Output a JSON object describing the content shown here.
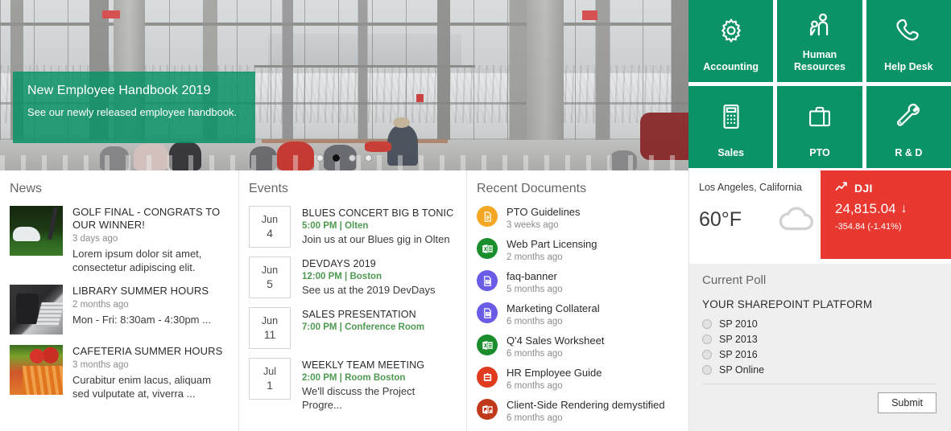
{
  "hero": {
    "title": "New Employee Handbook 2019",
    "subtitle": "See our newly released employee handbook.",
    "dots": [
      {
        "active": false
      },
      {
        "active": true
      },
      {
        "active": false
      },
      {
        "active": false
      }
    ]
  },
  "tiles": [
    {
      "label": "Accounting",
      "icon": "gear-icon",
      "color": "#0b9267"
    },
    {
      "label": "Human\nResources",
      "icon": "people-icon",
      "color": "#0b9267"
    },
    {
      "label": "Help Desk",
      "icon": "phone-icon",
      "color": "#0b9267"
    },
    {
      "label": "Sales",
      "icon": "calculator-icon",
      "color": "#0b9267"
    },
    {
      "label": "PTO",
      "icon": "briefcase-icon",
      "color": "#0b9267"
    },
    {
      "label": "R & D",
      "icon": "wrench-icon",
      "color": "#0b9267"
    }
  ],
  "news": {
    "title": "News",
    "items": [
      {
        "title": "GOLF FINAL - CONGRATS TO OUR WINNER!",
        "date": "3 days ago",
        "description": "Lorem ipsum dolor sit amet, consectetur adipiscing elit.",
        "thumb": "golf-thumbnail"
      },
      {
        "title": "LIBRARY SUMMER HOURS",
        "date": "2 months ago",
        "description": "Mon - Fri:  8:30am - 4:30pm ...",
        "thumb": "laptop-thumbnail"
      },
      {
        "title": "CAFETERIA SUMMER HOURS",
        "date": "3 months ago",
        "description": "Curabitur enim lacus, aliquam sed vulputate at, viverra ...",
        "thumb": "vegetables-thumbnail"
      }
    ]
  },
  "events": {
    "title": "Events",
    "items": [
      {
        "month": "Jun",
        "day": "4",
        "title": "BLUES CONCERT BIG B TONIC",
        "meta": "5:00 PM | Olten",
        "description": "Join us at our Blues gig in Olten"
      },
      {
        "month": "Jun",
        "day": "5",
        "title": "DEVDAYS 2019",
        "meta": "12:00 PM | Boston",
        "description": "See us at the 2019 DevDays"
      },
      {
        "month": "Jun",
        "day": "11",
        "title": "SALES PRESENTATION",
        "meta": "7:00 PM | Conference Room",
        "description": ""
      },
      {
        "month": "Jul",
        "day": "1",
        "title": "WEEKLY TEAM MEETING",
        "meta": "2:00 PM | Room Boston",
        "description": "We'll discuss the Project Progre..."
      }
    ]
  },
  "documents": {
    "title": "Recent Documents",
    "items": [
      {
        "title": "PTO Guidelines",
        "date": "3 weeks ago",
        "icon": "document-icon",
        "color": "#f5a623"
      },
      {
        "title": "Web Part Licensing",
        "date": "2 months ago",
        "icon": "excel-icon",
        "color": "#1a8d2c"
      },
      {
        "title": "faq-banner",
        "date": "5 months ago",
        "icon": "image-icon",
        "color": "#6b5ce7"
      },
      {
        "title": "Marketing Collateral",
        "date": "6 months ago",
        "icon": "image-icon",
        "color": "#6b5ce7"
      },
      {
        "title": "Q'4 Sales Worksheet",
        "date": "6 months ago",
        "icon": "excel-icon",
        "color": "#1a8d2c"
      },
      {
        "title": "HR Employee Guide",
        "date": "6 months ago",
        "icon": "zip-icon",
        "color": "#e03b1f"
      },
      {
        "title": "Client-Side Rendering demystified",
        "date": "6 months ago",
        "icon": "powerpoint-icon",
        "color": "#c0391b"
      }
    ]
  },
  "weather": {
    "city": "Los Angeles, California",
    "temperature": "60°F",
    "icon": "cloud-icon"
  },
  "stock": {
    "symbol": "DJI",
    "value": "24,815.04",
    "arrow": "↓",
    "change": "-354.84 (-1.41%)",
    "color": "#e8382f",
    "icon": "chart-line-icon"
  },
  "poll": {
    "title": "Current Poll",
    "question": "YOUR SHAREPOINT PLATFORM",
    "options": [
      {
        "label": "SP 2010",
        "selected": false
      },
      {
        "label": "SP 2013",
        "selected": false
      },
      {
        "label": "SP 2016",
        "selected": false
      },
      {
        "label": "SP Online",
        "selected": false
      }
    ],
    "submit_label": "Submit"
  }
}
